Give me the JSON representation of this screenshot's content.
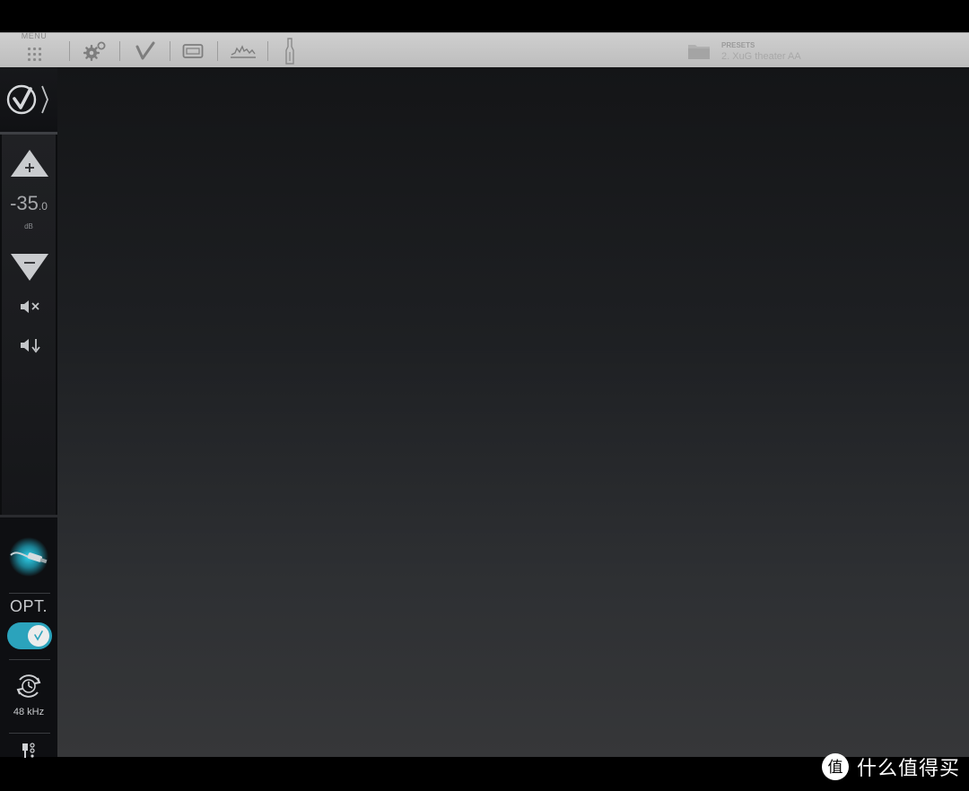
{
  "toolbar": {
    "menu_label": "MENU",
    "presets_label": "PRESETS",
    "preset_name": "2. XuG theater AA",
    "icons": [
      "menu-grid-icon",
      "settings-gears-icon",
      "checkmark-icon",
      "tv-screen-icon",
      "eq-graph-icon",
      "microphone-icon"
    ]
  },
  "sidebar": {
    "logo_icon": "dirac-logo-icon",
    "volume": {
      "value_main": "-35",
      "value_decimal": ".0",
      "unit": "dB"
    },
    "input": {
      "label": "OPT.",
      "enabled": true
    },
    "sample_rate": "48 kHz"
  },
  "watermark": {
    "text": "什么值得买",
    "icon": "zhi-badge-icon"
  },
  "colors": {
    "accent": "#2ba3bc",
    "toolbar_bg": "#c6c6c6",
    "content_top": "#141517",
    "content_bottom": "#363739"
  }
}
